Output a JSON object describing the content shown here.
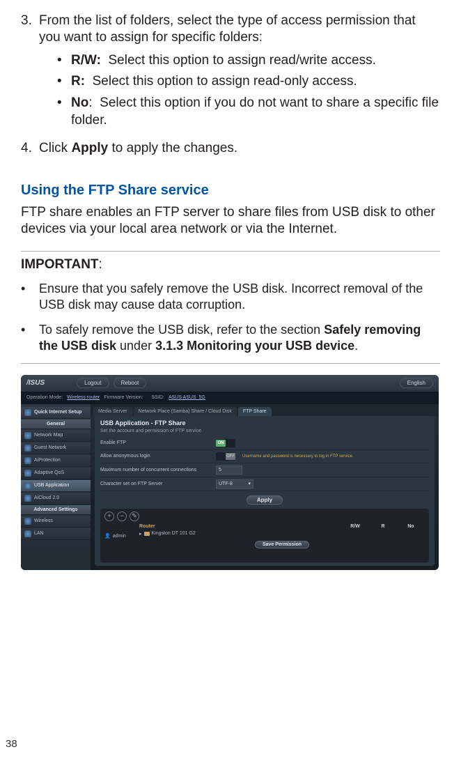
{
  "steps": {
    "s3": {
      "num": "3.",
      "text": "From the list of folders, select the type of access permission that you want to assign for specific folders:",
      "bullets": [
        {
          "key": "R/W:",
          "text": "Select this option to assign read/write access."
        },
        {
          "key": "R:",
          "text": "Select this option to assign read-only access."
        },
        {
          "key": "No",
          "colon": ":",
          "text": "Select this option if you do not want to share a specific file folder."
        }
      ]
    },
    "s4": {
      "num": "4.",
      "pre": "Click ",
      "bold": "Apply",
      "post": " to apply the changes."
    }
  },
  "section_title": "Using the FTP Share service",
  "intro": "FTP share enables an FTP server to share files from USB disk to other devices via your local area network or via the Internet.",
  "important_label": "IMPORTANT",
  "notes": [
    {
      "text_a": "Ensure that you safely remove the USB disk. Incorrect removal of the USB disk may cause data corruption."
    },
    {
      "pre": "To safely remove the USB disk, refer to the section ",
      "b1": "Safely removing the USB disk",
      "mid": " under ",
      "b2": "3.1.3 Monitoring your USB device",
      "post": "."
    }
  ],
  "shot": {
    "top": {
      "logout": "Logout",
      "reboot": "Reboot",
      "english": "English"
    },
    "info": {
      "opmode_label": "Operation Mode:",
      "opmode_value": "Wireless router",
      "fw_label": "Firmware Version:",
      "ssid_label": "SSID:",
      "ssid_value": "ASUS  ASUS_5G"
    },
    "sidebar": {
      "quick": "Quick Internet Setup",
      "general": "General",
      "items": [
        "Network Map",
        "Guest Network",
        "AiProtection",
        "Adaptive QoS",
        "USB Application",
        "AiCloud 2.0"
      ],
      "adv": "Advanced Settings",
      "adv_items": [
        "Wireless",
        "LAN"
      ]
    },
    "tabs": [
      "Media Server",
      "Network Place (Samba) Share / Cloud Disk",
      "FTP Share"
    ],
    "panel": {
      "title": "USB Application - FTP Share",
      "sub": "Set the account and permission of FTP service.",
      "rows": {
        "enable": "Enable FTP",
        "on": "ON",
        "anon": "Allow anonymous login",
        "off": "OFF",
        "hint": "Username and password is necessary to log in FTP service.",
        "maxconn": "Maximum number of concurrent connections",
        "maxval": "5",
        "charset": "Character set on FTP Server",
        "charval": "UTF-8"
      },
      "apply": "Apply"
    },
    "perm": {
      "user": "admin",
      "router": "Router",
      "cols": [
        "R/W",
        "R",
        "No"
      ],
      "device": "Kingston DT 101 G2",
      "save": "Save Permission"
    }
  },
  "page_number": "38"
}
